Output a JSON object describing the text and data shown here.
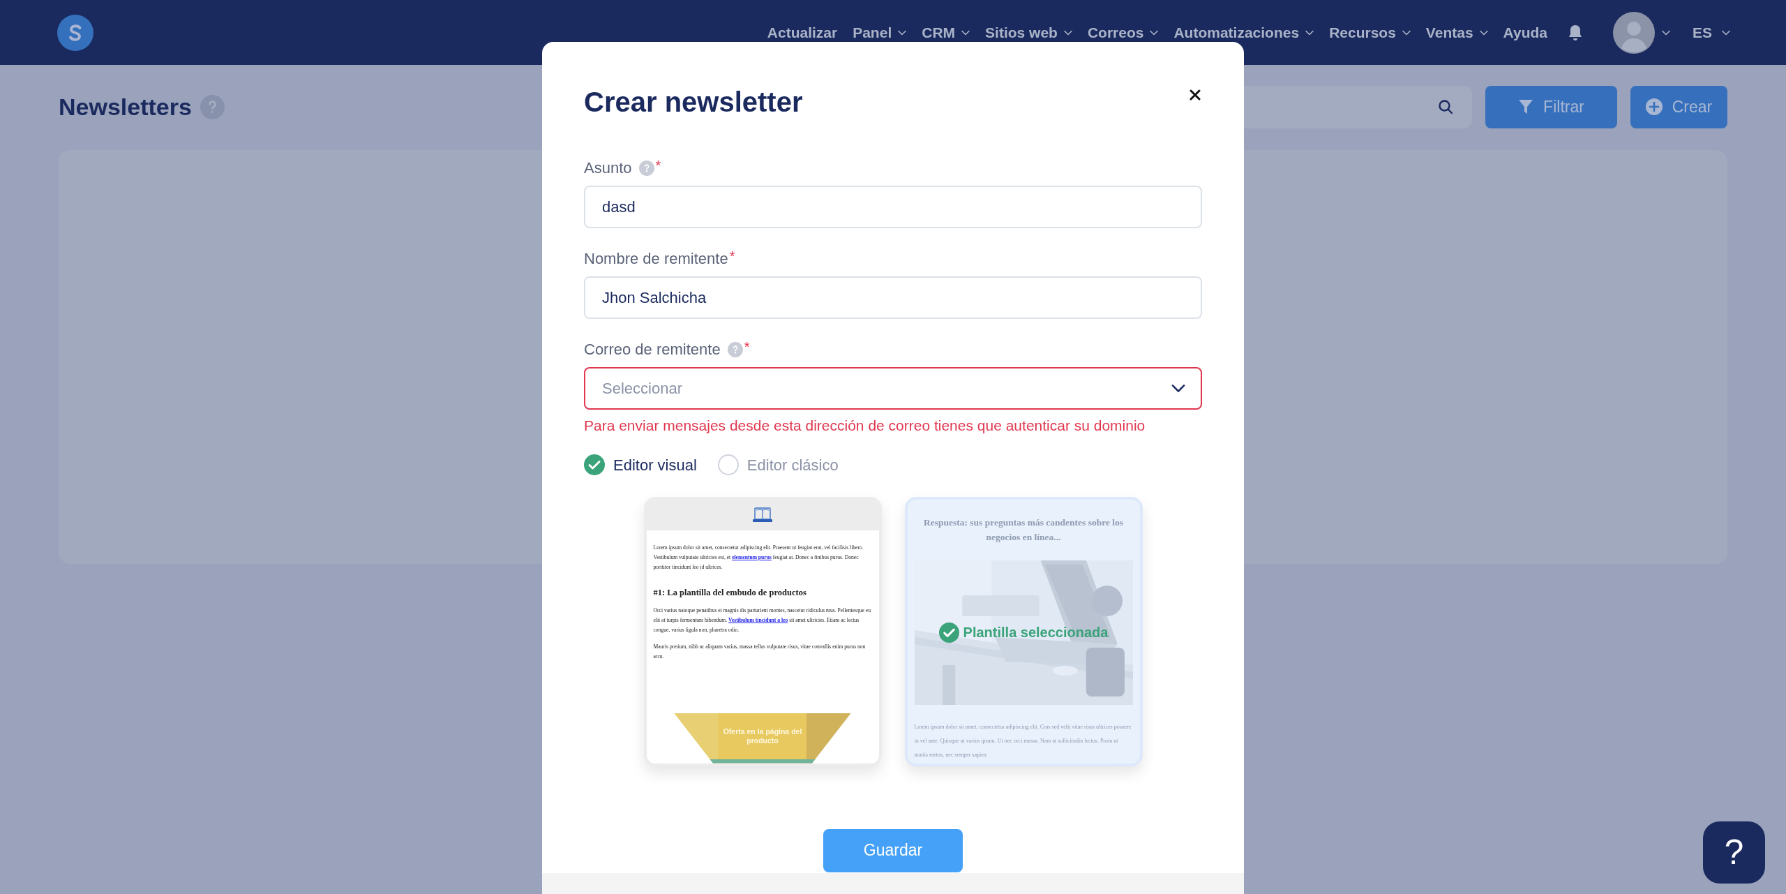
{
  "nav": {
    "items": [
      {
        "label": "Actualizar",
        "dropdown": false
      },
      {
        "label": "Panel",
        "dropdown": true
      },
      {
        "label": "CRM",
        "dropdown": true
      },
      {
        "label": "Sitios web",
        "dropdown": true
      },
      {
        "label": "Correos",
        "dropdown": true
      },
      {
        "label": "Automatizaciones",
        "dropdown": true
      },
      {
        "label": "Recursos",
        "dropdown": true
      },
      {
        "label": "Ventas",
        "dropdown": true
      },
      {
        "label": "Ayuda",
        "dropdown": false
      }
    ],
    "language": "ES"
  },
  "page": {
    "title": "Newsletters",
    "actions": [
      {
        "kind": "filter",
        "label": "Filtrar"
      },
      {
        "kind": "create",
        "label": "Crear"
      }
    ]
  },
  "modal": {
    "title": "Crear newsletter",
    "fields": [
      {
        "kind": "text",
        "label": "Asunto",
        "help": true,
        "required_mark": "*",
        "value": "dasd"
      },
      {
        "kind": "text",
        "label": "Nombre de remitente",
        "help": false,
        "required_mark": "*",
        "value": "Jhon Salchicha"
      },
      {
        "kind": "select",
        "label": "Correo de remitente",
        "help": true,
        "required_mark": "*",
        "placeholder": "Seleccionar",
        "error": "Para enviar mensajes desde esta dirección de correo tienes que autenticar su dominio"
      }
    ],
    "editor_options": [
      {
        "label": "Editor visual",
        "selected": true
      },
      {
        "label": "Editor clásico",
        "selected": false
      }
    ],
    "templates": {
      "selected_label": "Plantilla seleccionada",
      "items": [
        {
          "kind": "newsletter",
          "selected": false,
          "blocks": [
            {
              "kind": "paragraph",
              "parts": [
                {
                  "text": "Lorem ipsum dolor sit amet, consectetur adipiscing elit. Praesent ut feugiat erat, vel facilisis libero. Vestibulum vulputate ultricies est, et ",
                  "link": false
                },
                {
                  "text": "elementum purus",
                  "link": true
                },
                {
                  "text": " feugiat at. Donec a finibus purus. Donec porttitor tincidunt leo id ultrices.",
                  "link": false
                }
              ]
            },
            {
              "kind": "heading",
              "text": "#1: La plantilla del embudo de productos"
            },
            {
              "kind": "paragraph",
              "parts": [
                {
                  "text": "Orci varius natoque penatibus et magnis dis parturient montes, nascetur ridiculus mus. Pellentesque eu elit at turpis fermentum bibendum. ",
                  "link": false
                },
                {
                  "text": "Vestibulum tincidunt a leo",
                  "link": true
                },
                {
                  "text": " sit amet ultricies. Etiam ac lectus congue, varius ligula non, pharetra odio.",
                  "link": false
                }
              ]
            },
            {
              "kind": "paragraph",
              "parts": [
                {
                  "text": "Mauris pretium, nibh ac aliquam varius, massa tellus vulputate risus, vitae convallis enim purus non arcu.",
                  "link": false
                }
              ]
            }
          ],
          "banner": "Oferta en la página del producto"
        },
        {
          "kind": "article",
          "selected": true,
          "heading": "Respuesta: sus preguntas más candentes sobre los negocios en línea...",
          "paragraph": "Lorem ipsum dolor sit amet, consectetur adipiscing elit. Cras sed velit vitae risus ultrices posuere in vel ante. Quisque ut varius ipsum. Ut nec orci massa. Nam at sollicitudin lectus. Proin ut mattis metus, nec semper sapien."
        }
      ]
    },
    "save_button": "Guardar"
  },
  "help_button": "?"
}
